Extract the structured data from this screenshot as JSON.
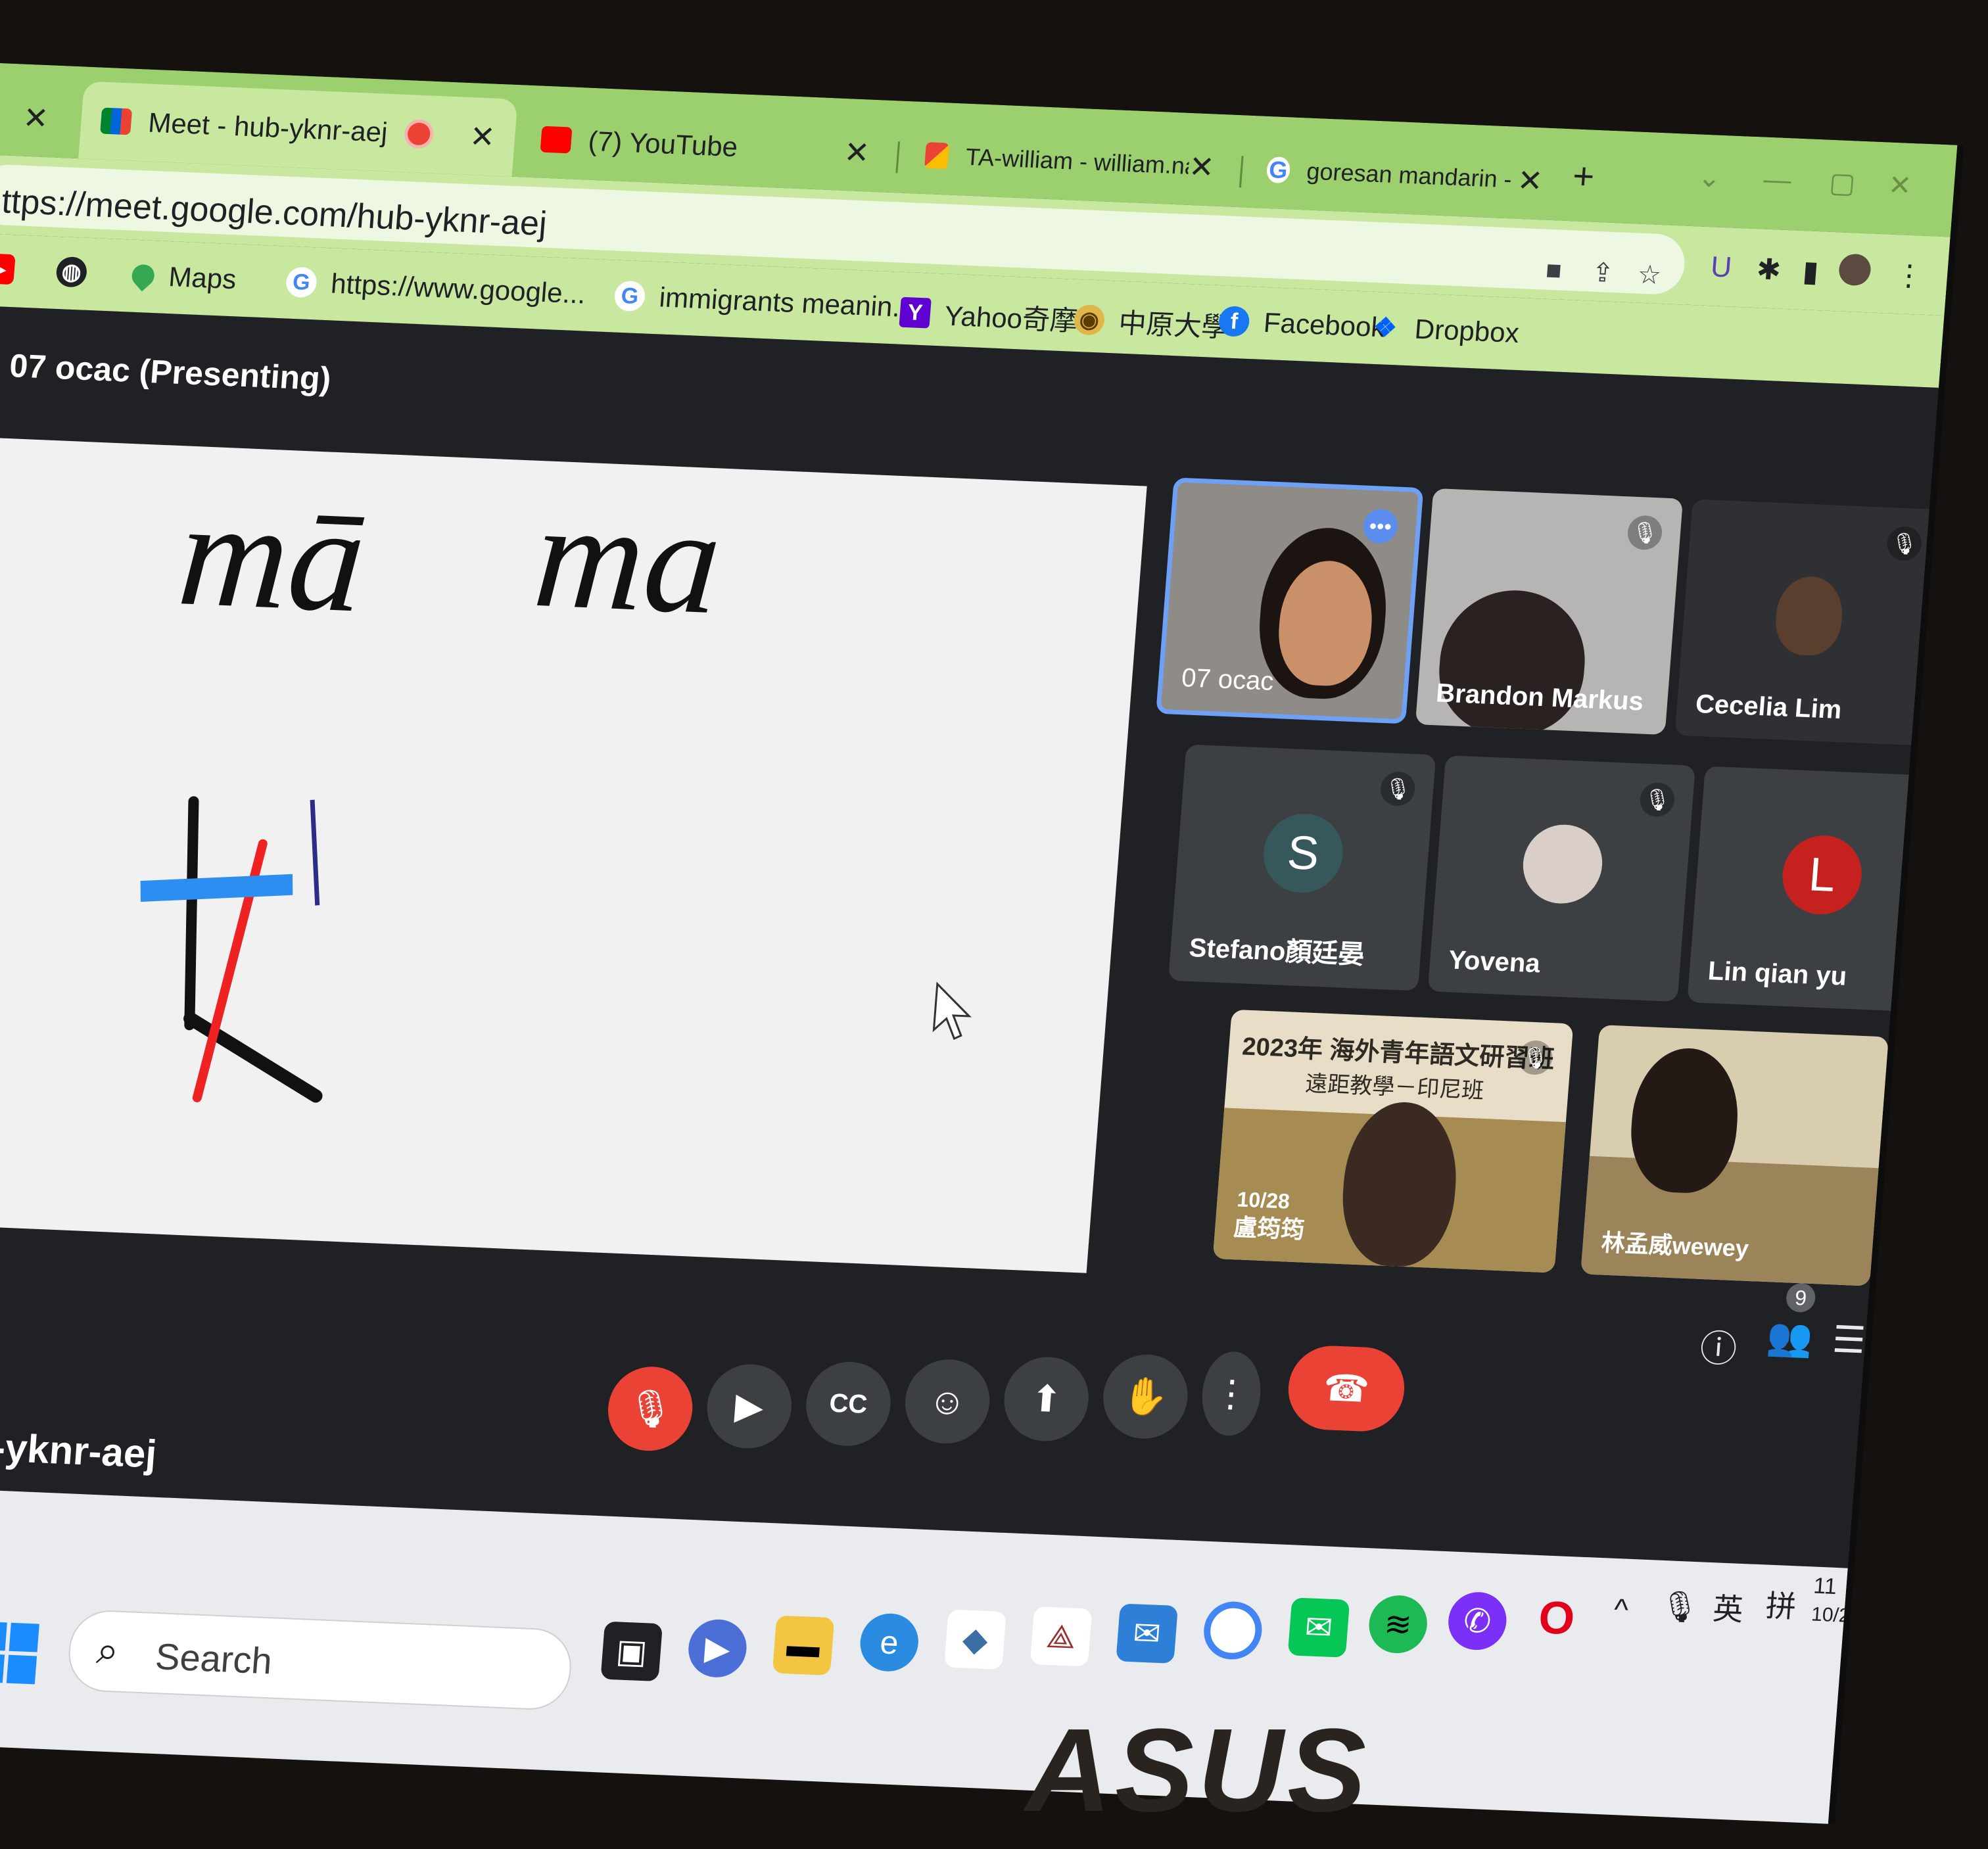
{
  "browser": {
    "tabs": [
      {
        "label": "Meet - hub-yknr-aej",
        "active": true,
        "recording": true
      },
      {
        "label": "(7) YouTube"
      },
      {
        "label": "TA-william - william.nath"
      },
      {
        "label": "goresan mandarin - Go"
      }
    ],
    "url": "https://meet.google.com/hub-yknr-aej",
    "bookmarks": [
      {
        "label": "Maps"
      },
      {
        "label": "https://www.google..."
      },
      {
        "label": "immigrants meanin..."
      },
      {
        "label": "Yahoo奇摩"
      },
      {
        "label": "中原大學"
      },
      {
        "label": "Facebook"
      },
      {
        "label": "Dropbox"
      }
    ],
    "accent_color": "#9ccf6e"
  },
  "meet": {
    "presenting_title": "07 ocac (Presenting)",
    "whiteboard_text": [
      "mā",
      "ma"
    ],
    "participants": [
      {
        "name": "07 ocac",
        "type": "video"
      },
      {
        "name": "Brandon Markus",
        "type": "video",
        "muted": true
      },
      {
        "name": "Cecelia Lim",
        "type": "video",
        "muted": true
      },
      {
        "name": "Stefano顏廷晏",
        "type": "avatar",
        "initial": "S",
        "muted": true
      },
      {
        "name": "Yovena",
        "type": "avatar",
        "muted": true
      },
      {
        "name": "Lin qian yu",
        "type": "avatar",
        "initial": "L"
      },
      {
        "name": "盧筠筠",
        "type": "video"
      },
      {
        "name": "林孟威wewey",
        "type": "video"
      }
    ],
    "poster_text": {
      "year_title": "2023年 海外青年語文研習班",
      "subtitle": "遠距教學－印尼班",
      "date": "10/28"
    },
    "participant_count": "9",
    "meeting_code": "hub-yknr-aej"
  },
  "taskbar": {
    "search_placeholder": "Search",
    "ime": [
      "英",
      "拼"
    ],
    "clock": [
      "11",
      "10/2"
    ]
  },
  "brand": "ASUS"
}
